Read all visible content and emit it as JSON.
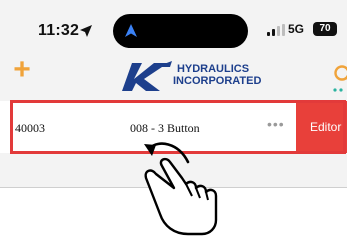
{
  "status_bar": {
    "time": "11:32",
    "network": "5G",
    "battery_level": "70",
    "location_icon": "location-arrow-icon",
    "signal_icon": "cellular-signal-icon"
  },
  "header": {
    "add_icon": "plus-icon",
    "add_label": "+",
    "logo_text_line1": "HYDRAULICS",
    "logo_text_line2": "INCORPORATED",
    "search_icon": "search-icon"
  },
  "list": {
    "rows": [
      {
        "id": "40003",
        "title": "008 - 3 Button",
        "more": "•••",
        "swipe_action": "Editor"
      }
    ]
  },
  "colors": {
    "accent_orange": "#f0a33a",
    "swipe_action_red": "#e8403a",
    "highlight_red": "#e23a3a",
    "logo_blue": "#1d3f8c"
  },
  "gesture": {
    "icon": "swipe-hand-icon"
  }
}
